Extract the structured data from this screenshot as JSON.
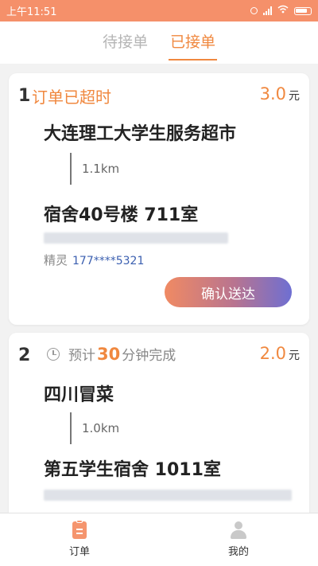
{
  "status_bar": {
    "time": "上午11:51"
  },
  "tabs": [
    {
      "label": "待接单",
      "active": false
    },
    {
      "label": "已接单",
      "active": true
    }
  ],
  "orders": [
    {
      "index": "1",
      "status": "订单已超时",
      "price": "3.0",
      "price_unit": "元",
      "shop": "大连理工大学生服务超市",
      "distance": "1.1km",
      "destination": "宿舍40号楼 711室",
      "contact_name": "精灵",
      "contact_phone": "177****5321",
      "action_label": "确认送达"
    },
    {
      "index": "2",
      "eta_prefix": "预计",
      "eta_minutes": "30",
      "eta_suffix": "分钟完成",
      "price": "2.0",
      "price_unit": "元",
      "shop": "四川冒菜",
      "distance": "1.0km",
      "destination": "第五学生宿舍 1011室"
    }
  ],
  "bottom_nav": [
    {
      "label": "订单",
      "icon": "clipboard-icon",
      "active": true
    },
    {
      "label": "我的",
      "icon": "user-icon",
      "active": false
    }
  ],
  "colors": {
    "accent": "#f0883f",
    "status_bar": "#f5906a",
    "button_start": "#f08a63",
    "button_end": "#6e6fd2"
  }
}
